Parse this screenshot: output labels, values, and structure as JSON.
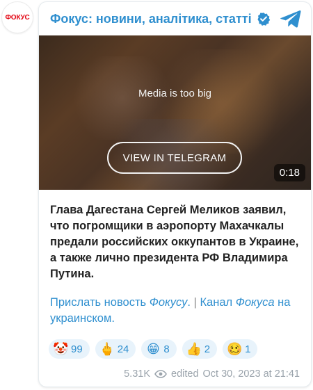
{
  "avatar": {
    "label": "ФОКУС"
  },
  "header": {
    "channel_name": "Фокус: новини, аналітика, статті"
  },
  "media": {
    "note": "Media is too big",
    "view_button": "VIEW IN TELEGRAM",
    "duration": "0:18"
  },
  "post": {
    "text": "Глава Дагестана Сергей Меликов заявил, что погромщики в аэропорту Махачкалы предали российских оккупантов в Украине, а также лично президента РФ Владимира Путина."
  },
  "links": {
    "part1": "Прислать новость ",
    "part2": "Фокусу",
    "part3": ".",
    "sep": " | ",
    "part4": "Канал",
    "part5": "Фокуса",
    "part6": " на украинском."
  },
  "reactions": [
    {
      "emoji": "🤡",
      "icon": "clown-icon",
      "count": "99"
    },
    {
      "emoji": "🖕",
      "icon": "middle-finger-icon",
      "count": "24"
    },
    {
      "emoji": "😁",
      "icon": "grin-icon",
      "count": "8"
    },
    {
      "emoji": "👍",
      "icon": "thumbs-up-icon",
      "count": "2"
    },
    {
      "emoji": "🥴",
      "icon": "woozy-face-icon",
      "count": "1"
    }
  ],
  "footer": {
    "views": "5.31K",
    "edited": "edited",
    "timestamp": "Oct 30, 2023 at 21:41"
  },
  "colors": {
    "accent": "#2f8fcf",
    "brand_red": "#e30613",
    "reaction_bg": "#e8f3fb"
  }
}
